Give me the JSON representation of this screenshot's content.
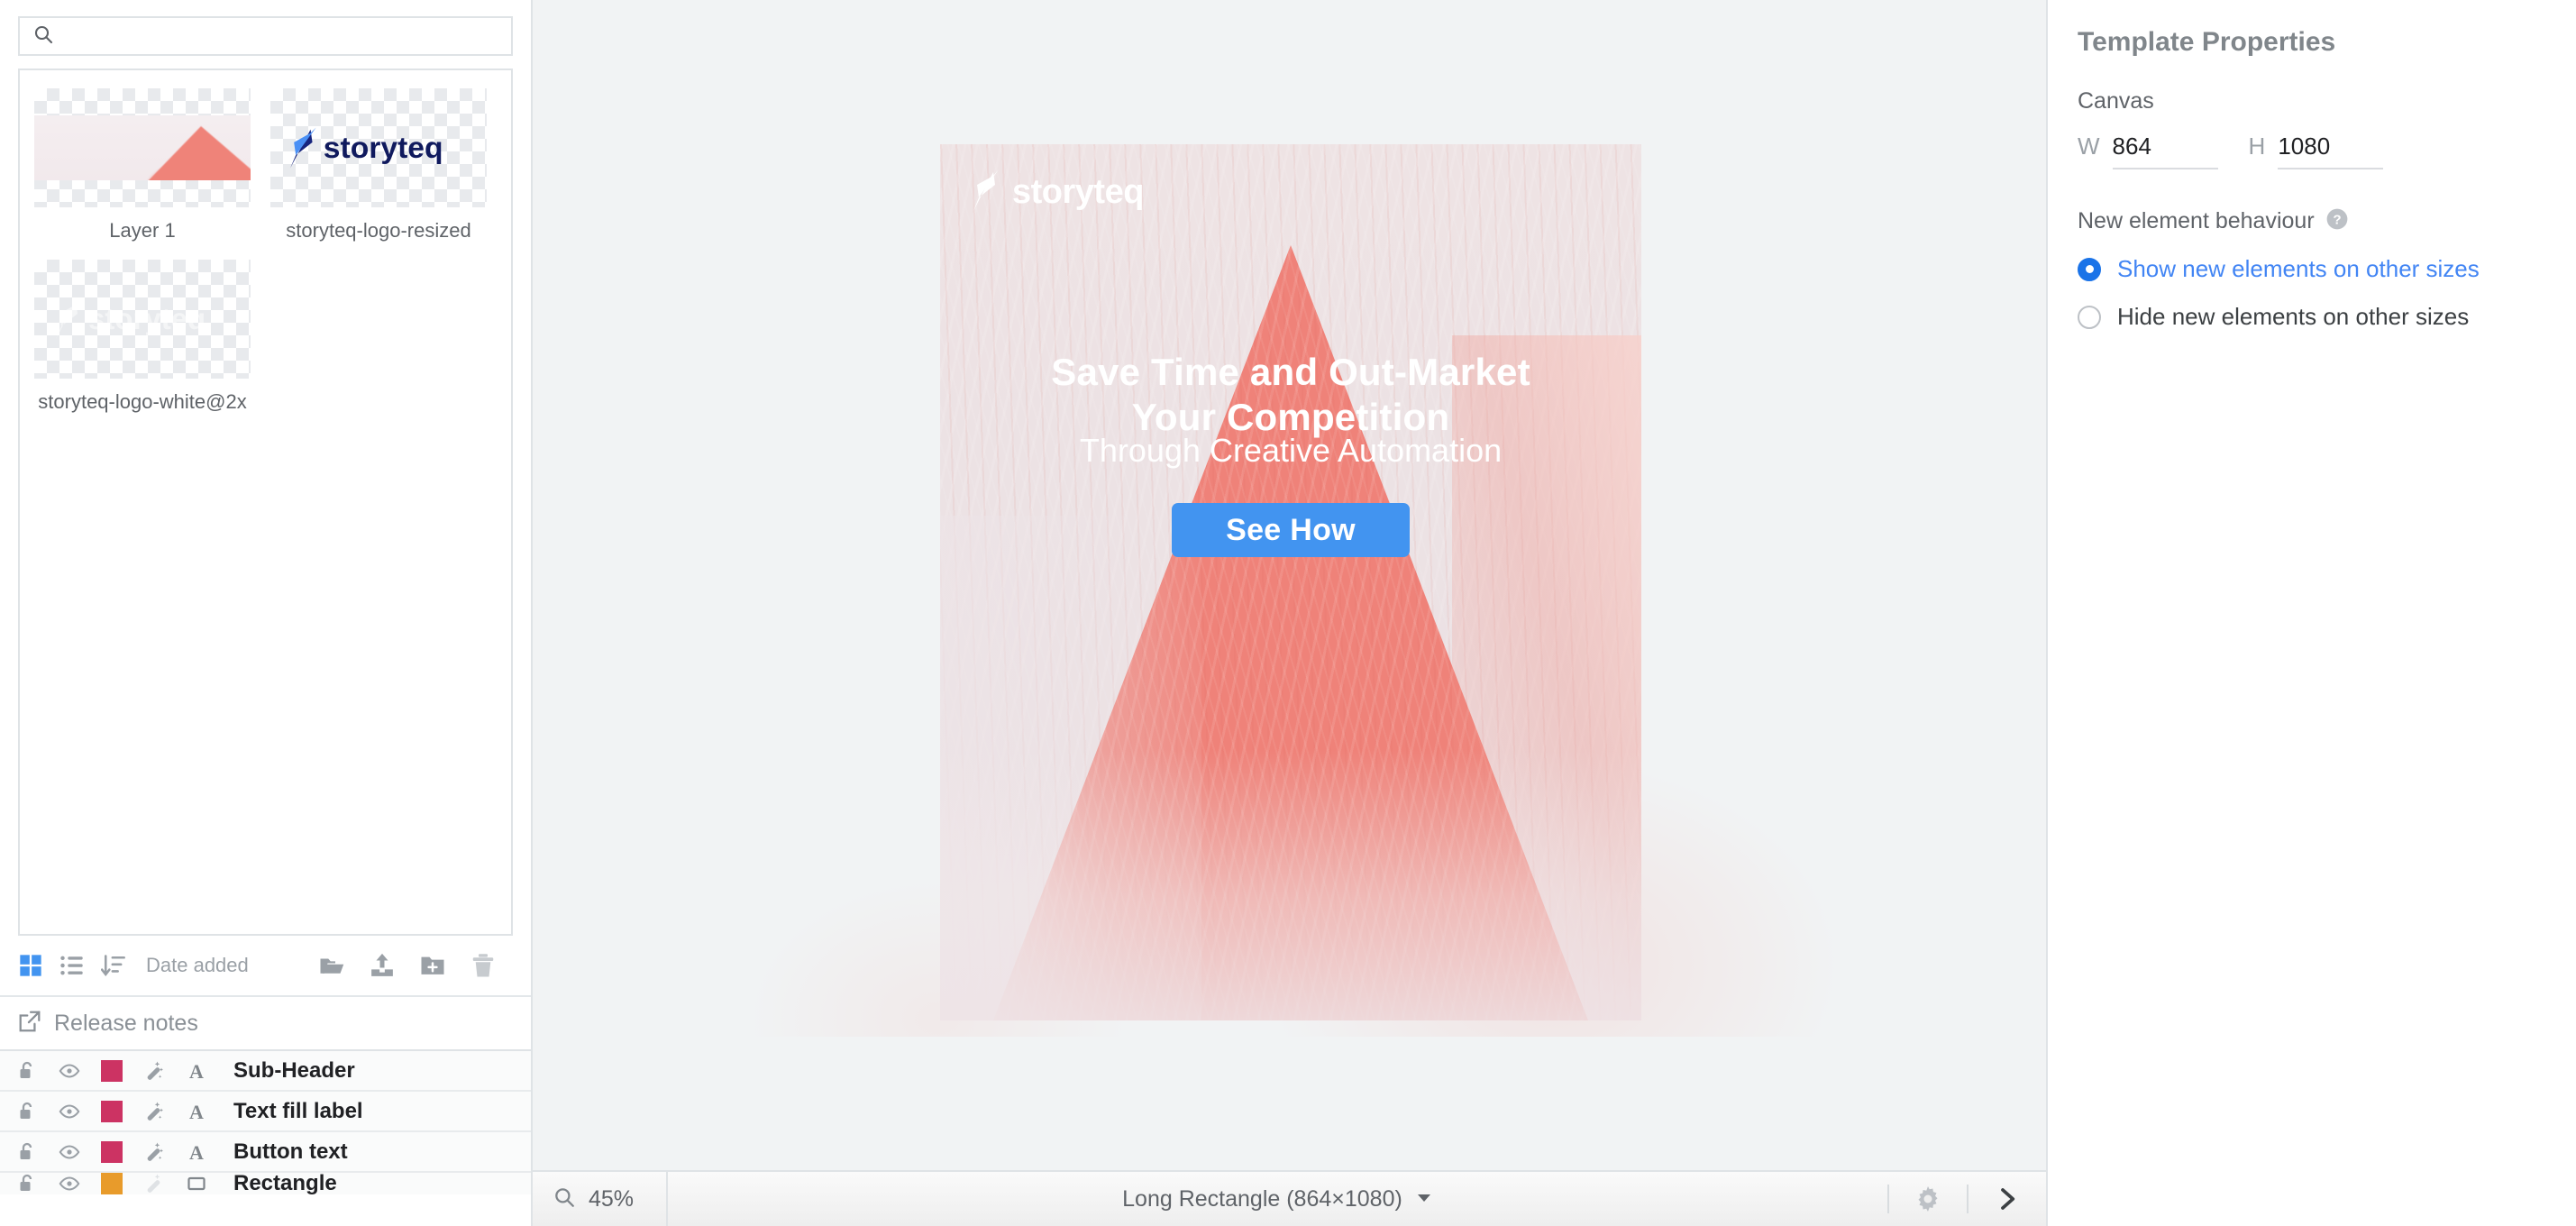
{
  "assets_panel": {
    "search": {
      "placeholder": "",
      "value": "",
      "icon": "search-icon"
    },
    "assets": [
      {
        "name": "Layer 1",
        "thumb": "mountain-image"
      },
      {
        "name": "storyteq-logo-resized",
        "thumb": "storyteq-logo-dark"
      },
      {
        "name": "storyteq-logo-white@2x",
        "thumb": "storyteq-logo-white"
      }
    ],
    "toolbar": {
      "grid_view_icon": "grid-view-icon",
      "list_view_icon": "list-view-icon",
      "sort_icon": "sort-descending-icon",
      "sort_label": "Date added",
      "open_folder_icon": "open-folder-icon",
      "upload_icon": "upload-icon",
      "new_folder_icon": "new-folder-icon",
      "delete_icon": "trash-icon",
      "active_view": "grid"
    }
  },
  "release_notes": {
    "label": "Release notes",
    "icon": "external-link-icon"
  },
  "layers": {
    "rows": [
      {
        "name": "Sub-Header",
        "color": "#cc3363",
        "type_icon": "text-type-icon",
        "lock": "unlocked",
        "visible": true,
        "magic": true
      },
      {
        "name": "Text fill label",
        "color": "#cc3363",
        "type_icon": "text-type-icon",
        "lock": "unlocked",
        "visible": true,
        "magic": true
      },
      {
        "name": "Button text",
        "color": "#cc3363",
        "type_icon": "text-type-icon",
        "lock": "unlocked",
        "visible": true,
        "magic": true
      },
      {
        "name": "Rectangle",
        "color": "#e89b2b",
        "type_icon": "rectangle-type-icon",
        "lock": "unlocked",
        "visible": true,
        "magic": false
      }
    ]
  },
  "canvas": {
    "artboard": {
      "logo_text": "storyteq",
      "headline_line1": "Save Time and Out-Market",
      "headline_line2": "Your Competition",
      "subheader": "Through Creative Automation",
      "cta_label": "See How",
      "cta_color": "#4294f0"
    }
  },
  "template_properties": {
    "title": "Template Properties",
    "canvas_label": "Canvas",
    "width_label": "W",
    "width_value": "864",
    "height_label": "H",
    "height_value": "1080",
    "behaviour_label": "New element behaviour",
    "help_icon": "help-circle-icon",
    "options": [
      {
        "label": "Show new elements on other sizes",
        "selected": true
      },
      {
        "label": "Hide new elements on other sizes",
        "selected": false
      }
    ],
    "accent_color": "#4285f4"
  },
  "statusbar": {
    "zoom_icon": "magnifier-icon",
    "zoom_value": "45%",
    "size_label": "Long Rectangle (864×1080)",
    "dropdown_icon": "caret-down-icon",
    "settings_icon": "gear-icon",
    "expand_icon": "chevron-right-icon"
  }
}
